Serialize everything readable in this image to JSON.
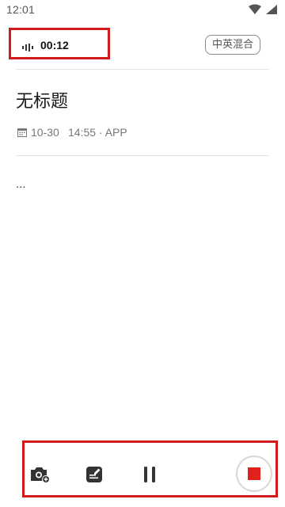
{
  "status_bar": {
    "time": "12:01",
    "icons": [
      "wifi-icon",
      "cellular-signal-icon"
    ]
  },
  "recording": {
    "elapsed": "00:12",
    "icon": "audio-wave-icon"
  },
  "language_chip": {
    "label": "中英混合"
  },
  "note": {
    "title": "无标题",
    "date": "10-30",
    "time_source": "14:55 · APP",
    "content": "..."
  },
  "toolbar": {
    "buttons": [
      "camera-add-icon",
      "note-edit-icon",
      "pause-icon",
      "stop-icon"
    ],
    "stop_color": "#e0211d"
  },
  "highlight_color": "#d11a1a"
}
